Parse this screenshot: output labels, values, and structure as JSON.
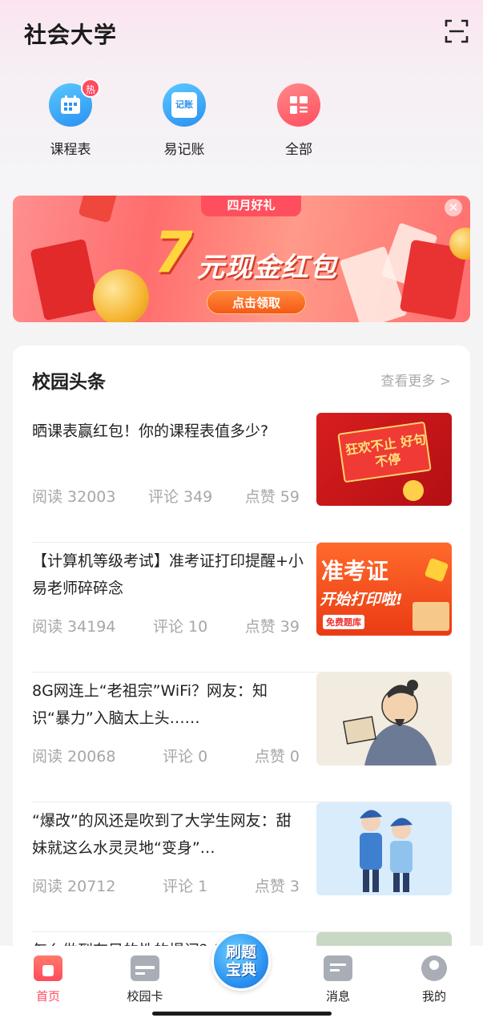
{
  "header": {
    "title": "社会大学"
  },
  "quick_actions": [
    {
      "label": "课程表",
      "badge": "热"
    },
    {
      "label": "易记账",
      "icon_text": "记账"
    },
    {
      "label": "全部"
    }
  ],
  "banner": {
    "tag": "四月好礼",
    "big_number": "7",
    "main_text": "元现金红包",
    "button": "点击领取",
    "close": "✕"
  },
  "news": {
    "title": "校园头条",
    "more": "查看更多 >",
    "items": [
      {
        "title": "晒课表赢红包！你的课程表值多少?",
        "read": "阅读 32003",
        "comment": "评论 349",
        "like": "点赞 59",
        "thumb_text": "狂欢不止 好句不停"
      },
      {
        "title": "【计算机等级考试】准考证打印提醒+小易老师碎碎念",
        "read": "阅读 34194",
        "comment": "评论 10",
        "like": "点赞 39",
        "thumb_line1": "准考证",
        "thumb_line2": "开始打印啦!",
        "thumb_tag": "免费题库"
      },
      {
        "title": "8G网连上“老祖宗”WiFi？网友：知识“暴力”入脑太上头……",
        "read": "阅读 20068",
        "comment": "评论 0",
        "like": "点赞 0"
      },
      {
        "title": "“爆改”的风还是吹到了大学生网友：甜妹就这么水灵灵地“变身”…",
        "read": "阅读 20712",
        "comment": "评论 1",
        "like": "点赞 3"
      },
      {
        "title": "怎么做到有目的性的提问？我发现"
      }
    ]
  },
  "tabbar": {
    "tabs": [
      {
        "label": "首页"
      },
      {
        "label": "校园卡"
      },
      {
        "label": "消息"
      },
      {
        "label": "我的"
      }
    ],
    "center_line1": "刷题",
    "center_line2": "宝典"
  },
  "colors": {
    "accent": "#ff4a5e",
    "blue": "#2a8ff0"
  }
}
